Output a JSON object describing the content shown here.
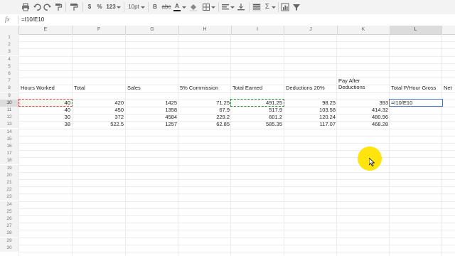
{
  "toolbar": {
    "currency": "$",
    "percent": "%",
    "number_format": "123",
    "font_size": "10pt",
    "bold": "B",
    "strike": "abc",
    "text_color": "A",
    "sum": "Σ"
  },
  "formula_bar": {
    "fx": "fx",
    "value": "=I10/E10"
  },
  "columns": [
    "E",
    "F",
    "G",
    "H",
    "I",
    "J",
    "K",
    "L"
  ],
  "rows": [
    "1",
    "2",
    "3",
    "4",
    "5",
    "6",
    "7",
    "8",
    "9",
    "10",
    "11",
    "12",
    "13",
    "14",
    "15",
    "16",
    "17",
    "18",
    "19",
    "20",
    "21",
    "22",
    "23",
    "24",
    "25",
    "26",
    "27",
    "28",
    "29",
    "30"
  ],
  "headers": {
    "hours_worked": "Hours Worked",
    "total": "Total",
    "sales": "Sales",
    "commission": "5% Commission",
    "total_earned": "Total Earned",
    "deductions": "Deductions 20%",
    "pay_after_deductions": "Pay After Deductions",
    "total_per_hour": "Total P/Hour Gross",
    "net": "Net"
  },
  "table": [
    {
      "hours": "40",
      "total": "420",
      "sales": "1425",
      "commission": "71.25",
      "earned": "491.25",
      "deductions": "98.25",
      "pay": "393",
      "per_hour": "=I10/E10"
    },
    {
      "hours": "40",
      "total": "450",
      "sales": "1358",
      "commission": "67.9",
      "earned": "517.9",
      "deductions": "103.58",
      "pay": "414.32",
      "per_hour": ""
    },
    {
      "hours": "30",
      "total": "372",
      "sales": "4584",
      "commission": "229.2",
      "earned": "601.2",
      "deductions": "120.24",
      "pay": "480.96",
      "per_hour": ""
    },
    {
      "hours": "38",
      "total": "522.5",
      "sales": "1257",
      "commission": "62.85",
      "earned": "585.35",
      "deductions": "117.07",
      "pay": "468.28",
      "per_hour": ""
    }
  ],
  "active_cell": "L10",
  "colors": {
    "accent": "#4a72c8",
    "cursor_highlight": "#ffe400",
    "copy_marquee": "#2a8a3a",
    "reference_marquee": "#d44444"
  }
}
